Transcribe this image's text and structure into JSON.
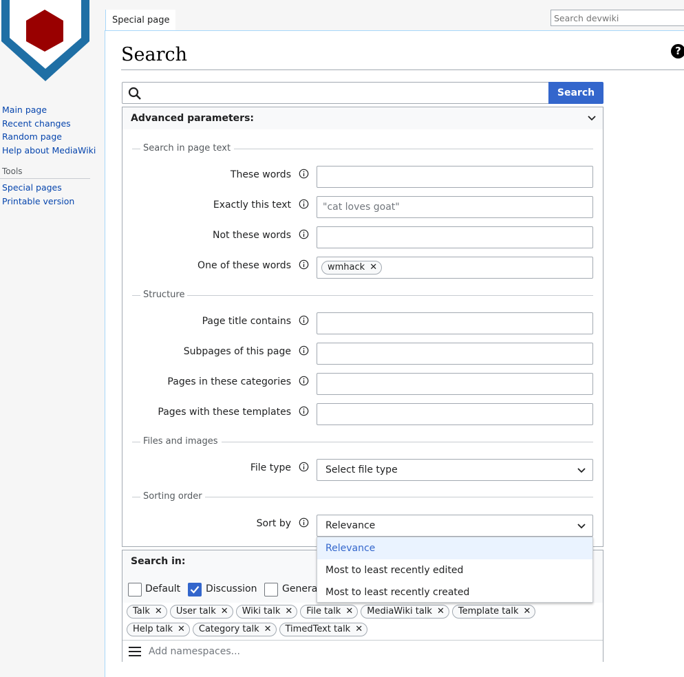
{
  "colors": {
    "accent": "#3366cc",
    "logo_ring": "#1f6fa5",
    "logo_core": "#990000"
  },
  "tabs": {
    "special": "Special page"
  },
  "top_search": {
    "placeholder": "Search devwiki"
  },
  "sidebar": {
    "nav": [
      "Main page",
      "Recent changes",
      "Random page",
      "Help about MediaWiki"
    ],
    "tools_heading": "Tools",
    "tools": [
      "Special pages",
      "Printable version"
    ]
  },
  "page": {
    "title": "Search",
    "help": "?"
  },
  "search": {
    "value": "",
    "button": "Search"
  },
  "advanced": {
    "header": "Advanced parameters:",
    "sections": {
      "page_text": "Search in page text",
      "structure": "Structure",
      "files": "Files and images",
      "sorting": "Sorting order"
    },
    "fields": {
      "these_words": {
        "label": "These words",
        "value": ""
      },
      "exactly": {
        "label": "Exactly this text",
        "placeholder": "\"cat loves goat\""
      },
      "not_words": {
        "label": "Not these words",
        "value": ""
      },
      "one_of": {
        "label": "One of these words",
        "tags": [
          "wmhack"
        ]
      },
      "title_contains": {
        "label": "Page title contains",
        "value": ""
      },
      "subpages": {
        "label": "Subpages of this page",
        "value": ""
      },
      "categories": {
        "label": "Pages in these categories",
        "value": ""
      },
      "templates": {
        "label": "Pages with these templates",
        "value": ""
      },
      "file_type": {
        "label": "File type",
        "selected": "Select file type"
      },
      "sort_by": {
        "label": "Sort by",
        "selected": "Relevance",
        "options": [
          "Relevance",
          "Most to least recently edited",
          "Most to least recently created"
        ]
      }
    }
  },
  "search_in": {
    "header": "Search in:",
    "checkboxes": [
      {
        "label": "Default",
        "checked": false
      },
      {
        "label": "Discussion",
        "checked": true
      },
      {
        "label": "Genera",
        "checked": false
      }
    ],
    "namespaces_row1": [
      "Talk",
      "User talk",
      "Wiki talk",
      "File talk",
      "MediaWiki talk",
      "Template talk"
    ],
    "namespaces_row2": [
      "Help talk",
      "Category talk",
      "TimedText talk"
    ],
    "add_placeholder": "Add namespaces..."
  }
}
